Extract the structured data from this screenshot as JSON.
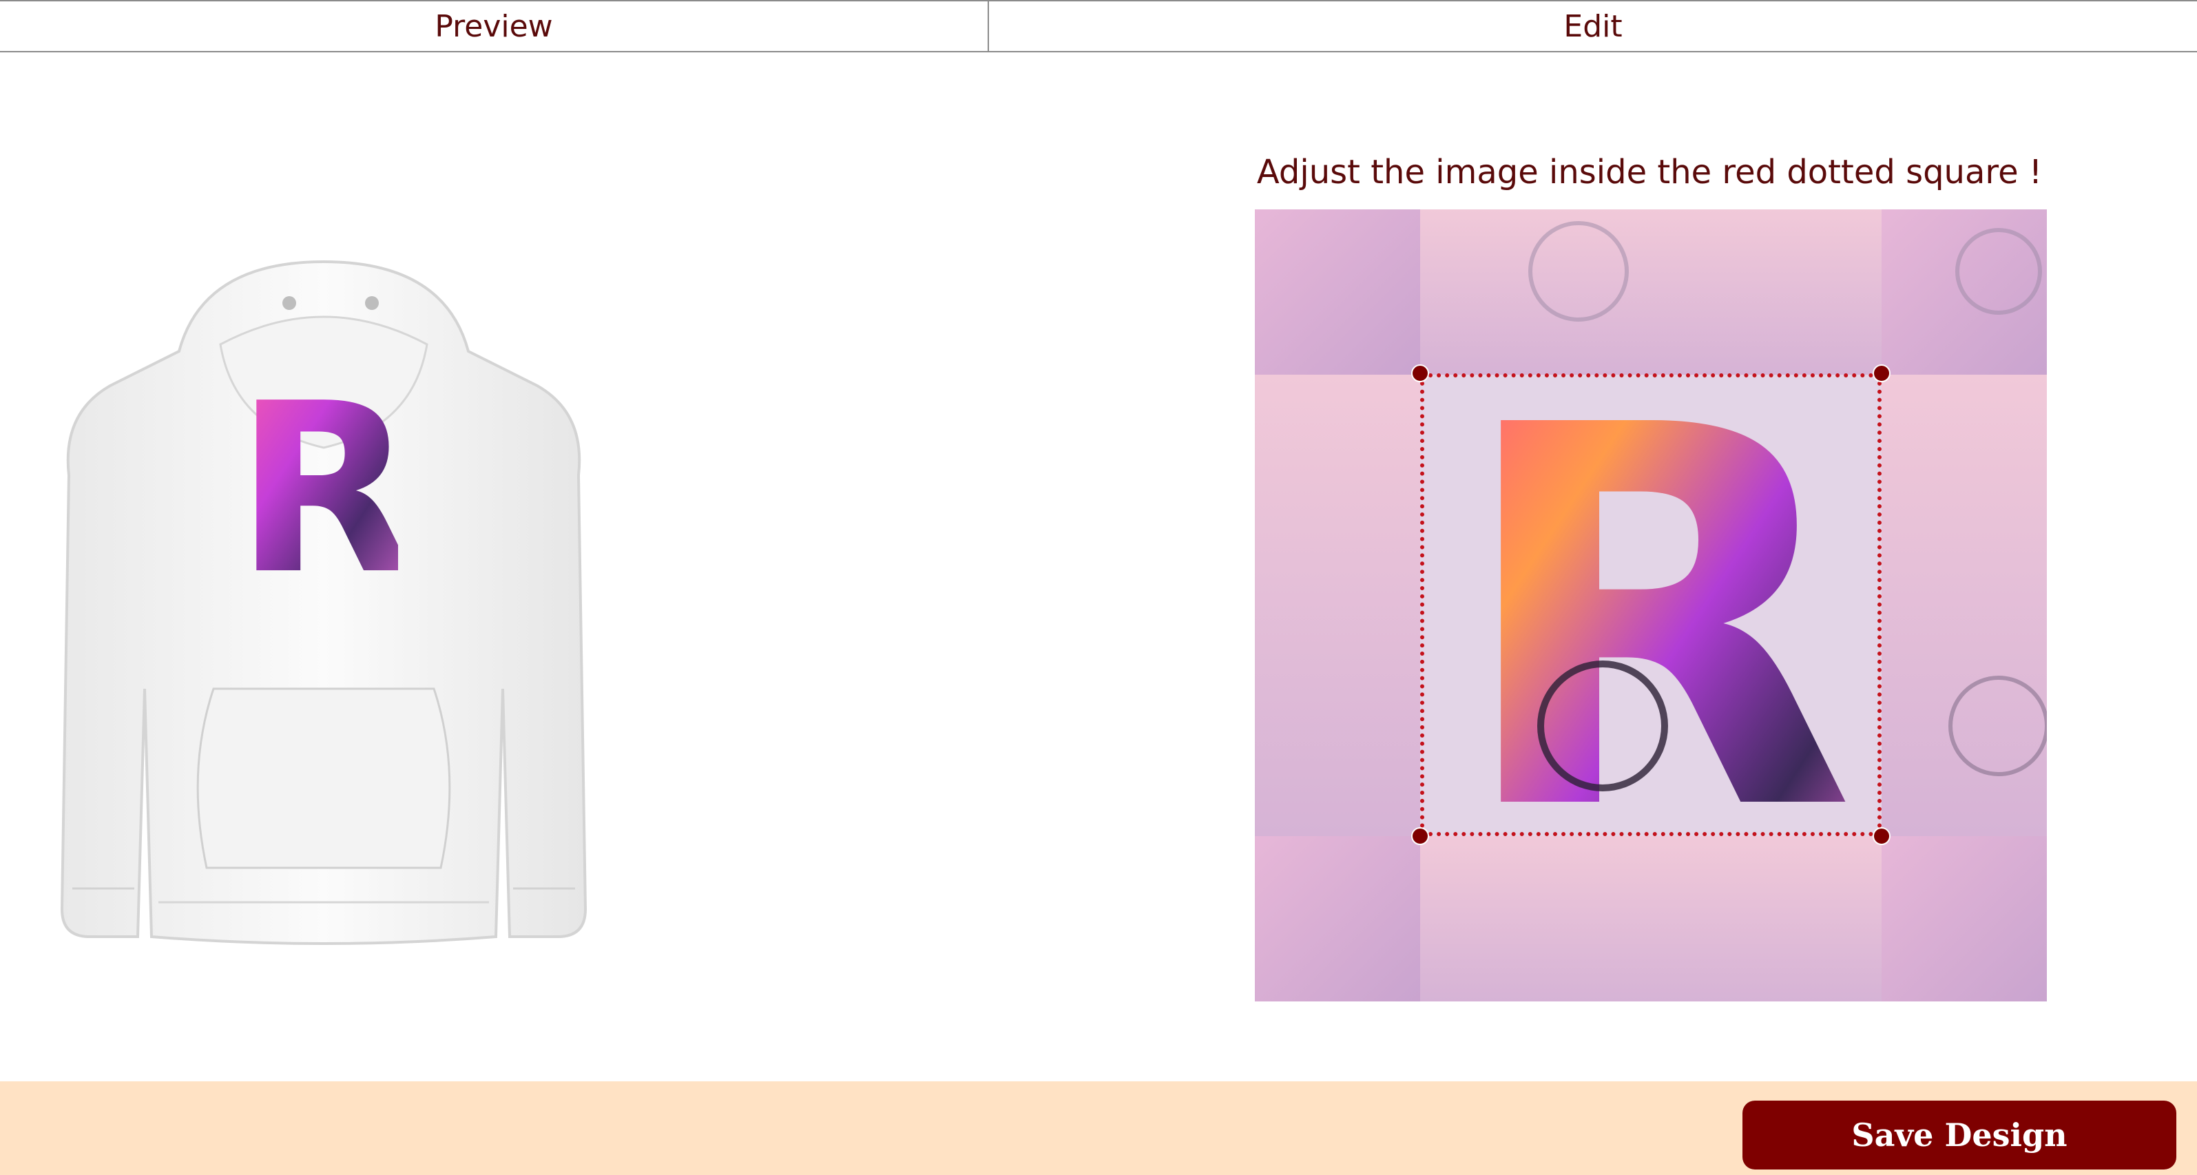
{
  "tabs": [
    {
      "label": "Preview"
    },
    {
      "label": "Edit"
    }
  ],
  "edit": {
    "instruction": "Adjust the image inside the red dotted square !"
  },
  "design": {
    "letter": "R"
  },
  "footer": {
    "save_label": "Save Design"
  },
  "colors": {
    "brand_dark_red": "#7e0000",
    "text_red": "#5a0a0a",
    "dotted_border": "#c4121b",
    "footer_bg": "#ffe2c4"
  },
  "icons": {
    "product": "hoodie",
    "handles": "round-resize-handles"
  }
}
